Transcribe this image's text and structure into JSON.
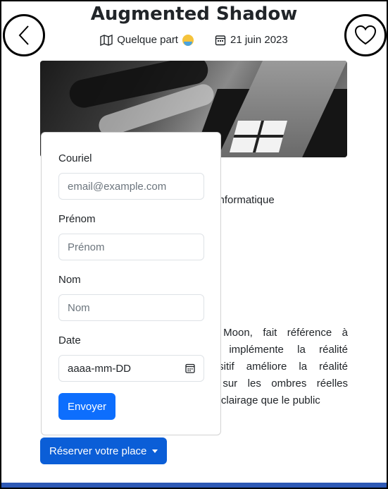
{
  "header": {
    "title": "Augmented Shadow",
    "location": "Quelque part",
    "date": "21 juin 2023"
  },
  "nav": {
    "back_icon": "chevron-left-icon",
    "favorite_icon": "heart-icon"
  },
  "background_text": {
    "line1": "r informatique",
    "paragraph": [
      "on Moon, fait référence à",
      "qui implémente la réalité",
      "spositif améliore la réalité",
      "es sur les ombres réelles",
      "f d'éclairage que le public"
    ]
  },
  "form": {
    "email_label": "Couriel",
    "email_placeholder": "email@example.com",
    "firstname_label": "Prénom",
    "firstname_placeholder": "Prénom",
    "lastname_label": "Nom",
    "lastname_placeholder": "Nom",
    "date_label": "Date",
    "date_value": "aaaa-mm-DD",
    "submit_label": "Envoyer"
  },
  "reserve": {
    "label": "Réserver votre place"
  },
  "colors": {
    "primary": "#0d6efd",
    "reserve": "#0b5ed7",
    "bottom_bar": "#2e59b5"
  }
}
